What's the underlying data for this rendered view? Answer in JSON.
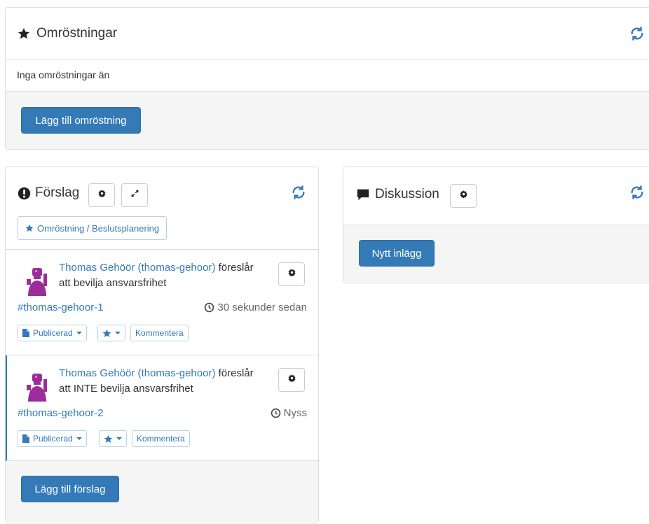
{
  "polls": {
    "title": "Omröstningar",
    "empty_text": "Inga omröstningar än",
    "add_button": "Lägg till omröstning"
  },
  "proposals": {
    "title": "Förslag",
    "filter_tag": "Omröstning / Beslutsplanering",
    "add_button": "Lägg till förslag",
    "items": [
      {
        "author": "Thomas Gehöör (thomas-gehoor)",
        "verb": "föreslår",
        "text": "att bevilja ansvarsfrihet",
        "hashtag": "#thomas-gehoor-1",
        "time": "30 sekunder sedan",
        "status": "Publicerad",
        "comment": "Kommentera"
      },
      {
        "author": "Thomas Gehöör (thomas-gehoor)",
        "verb": "föreslår",
        "text": "att INTE bevilja ansvarsfrihet",
        "hashtag": "#thomas-gehoor-2",
        "time": "Nyss",
        "status": "Publicerad",
        "comment": "Kommentera"
      }
    ]
  },
  "discussion": {
    "title": "Diskussion",
    "new_post_button": "Nytt inlägg"
  },
  "colors": {
    "primary": "#337ab7",
    "border": "#dddddd",
    "footer_bg": "#f5f5f5",
    "avatar": "#9b2d9b"
  },
  "icons": [
    "star-icon",
    "refresh-icon",
    "exclamation-circle-icon",
    "gear-icon",
    "expand-icon",
    "comment-icon",
    "clock-icon",
    "file-icon"
  ]
}
